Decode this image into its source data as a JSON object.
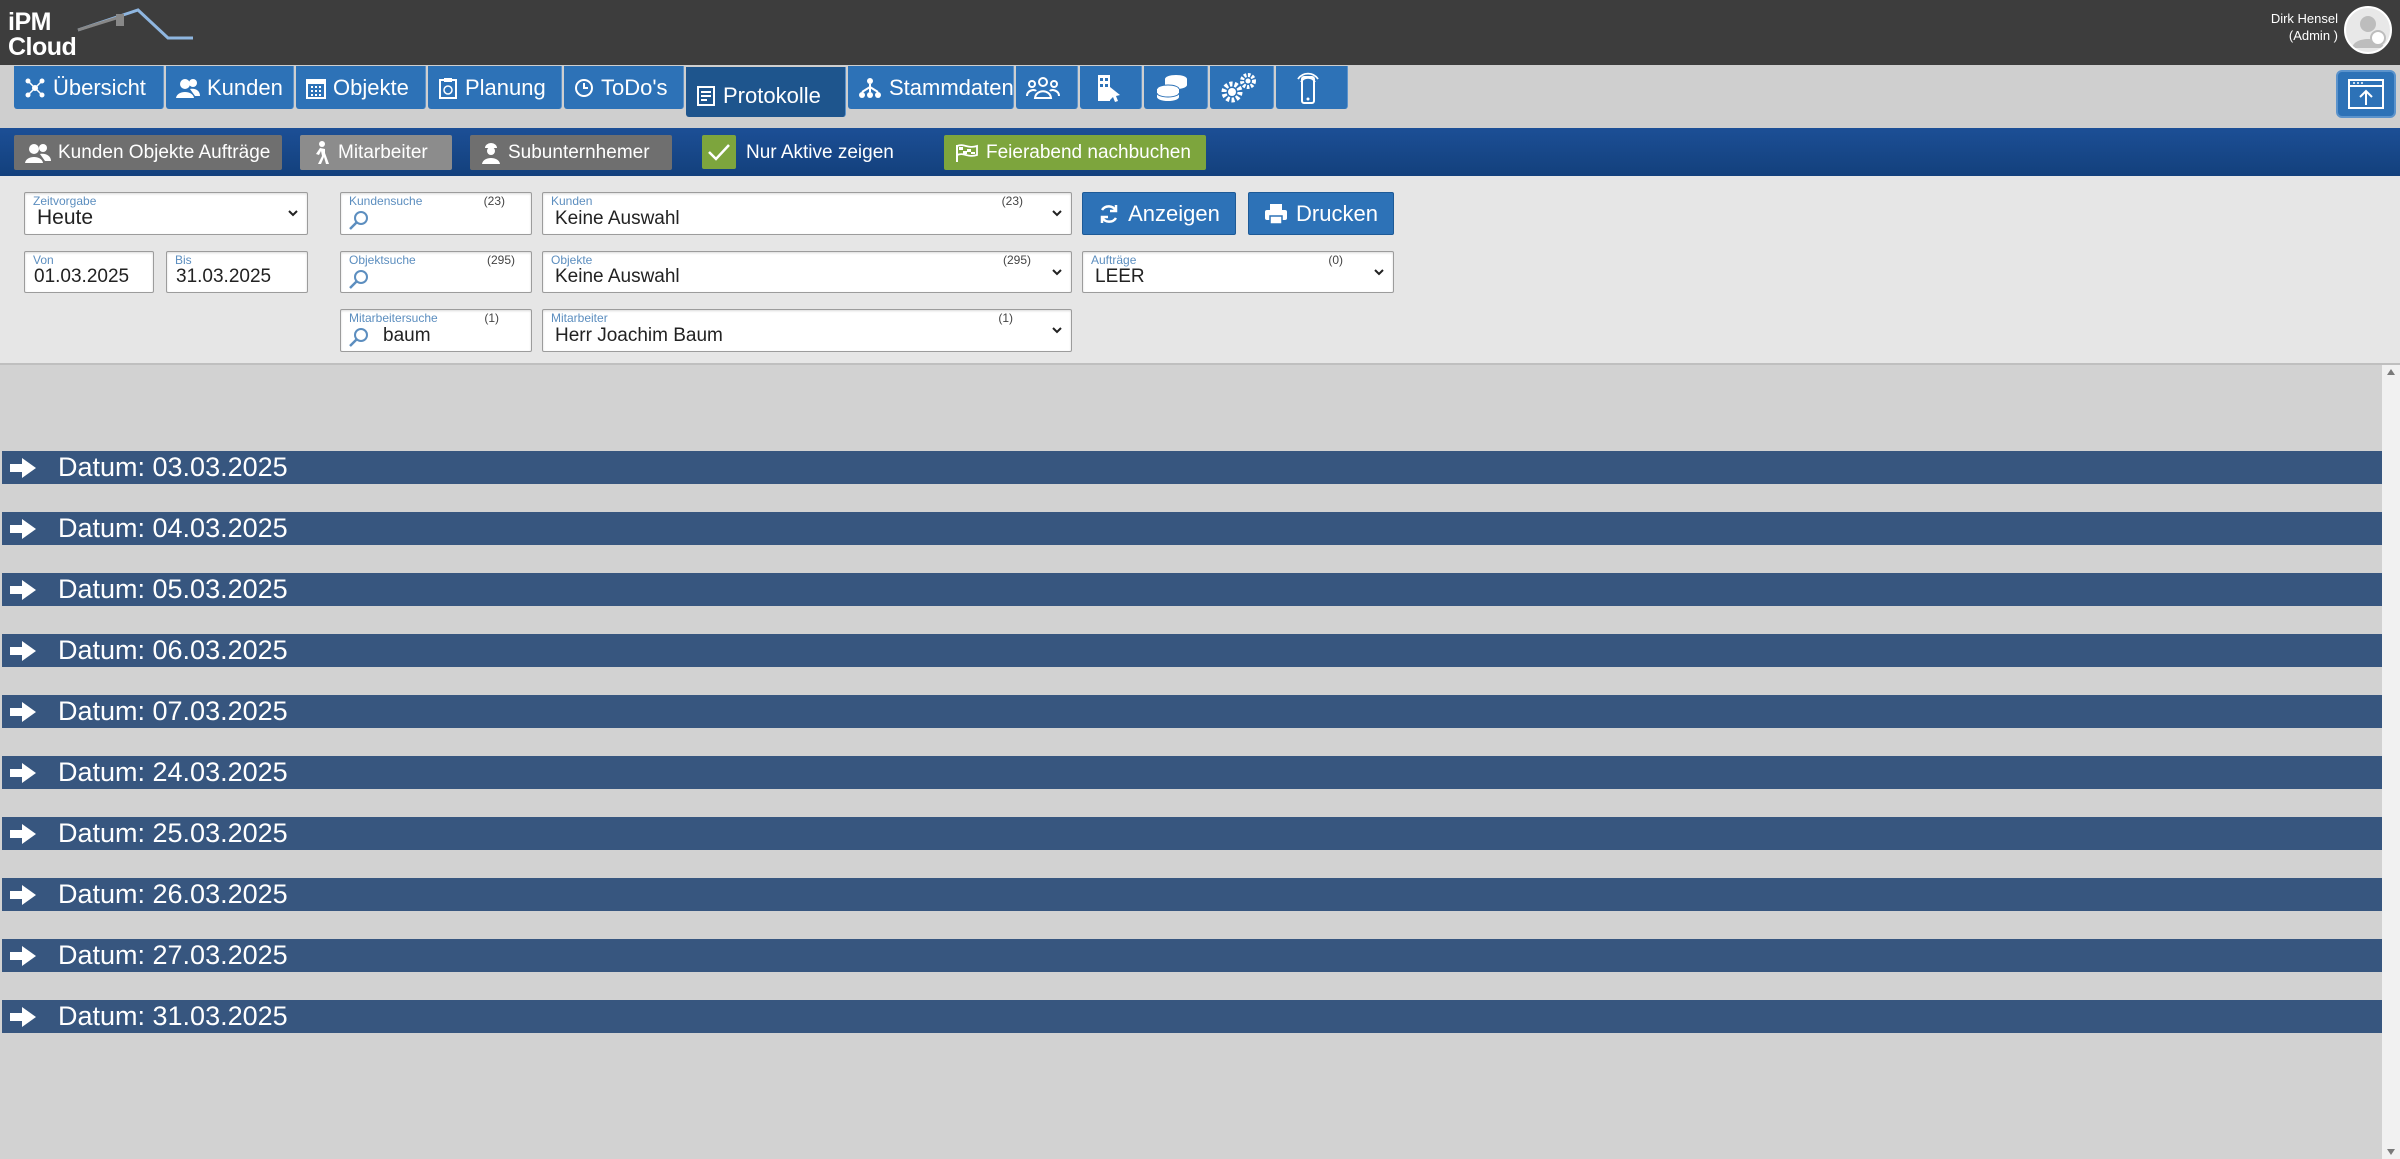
{
  "header": {
    "logo_line1": "iPM",
    "logo_line2": "Cloud",
    "user_name": "Dirk Hensel",
    "user_role": "(Admin )"
  },
  "nav": {
    "tabs": [
      {
        "label": "Übersicht",
        "icon": "network-icon"
      },
      {
        "label": "Kunden",
        "icon": "users-icon"
      },
      {
        "label": "Objekte",
        "icon": "building-icon"
      },
      {
        "label": "Planung",
        "icon": "clipboard-icon"
      },
      {
        "label": "ToDo's",
        "icon": "clock-icon"
      },
      {
        "label": "Protokolle",
        "icon": "document-icon"
      },
      {
        "label": "Stammdaten",
        "icon": "hierarchy-icon"
      }
    ],
    "icon_tabs": [
      "group-icon",
      "office-icon",
      "coins-icon",
      "gears-icon",
      "mobile-icon"
    ]
  },
  "band": {
    "btn_kunden": "Kunden Objekte Aufträge",
    "btn_mitarbeiter": "Mitarbeiter",
    "btn_subunternehmer": "Subunternhemer",
    "nur_aktive": "Nur Aktive zeigen",
    "feierabend": "Feierabend nachbuchen"
  },
  "filters": {
    "zeitvorgabe": {
      "label": "Zeitvorgabe",
      "value": "Heute"
    },
    "von": {
      "label": "Von",
      "value": "01.03.2025"
    },
    "bis": {
      "label": "Bis",
      "value": "31.03.2025"
    },
    "kundensuche": {
      "label": "Kundensuche",
      "count": "(23)",
      "value": ""
    },
    "kunden": {
      "label": "Kunden",
      "count": "(23)",
      "value": "Keine Auswahl"
    },
    "objektsuche": {
      "label": "Objektsuche",
      "count": "(295)",
      "value": ""
    },
    "objekte": {
      "label": "Objekte",
      "count": "(295)",
      "value": "Keine Auswahl"
    },
    "mitarbeitersuche": {
      "label": "Mitarbeitersuche",
      "count": "(1)",
      "value": "baum"
    },
    "mitarbeiter": {
      "label": "Mitarbeiter",
      "count": "(1)",
      "value": "Herr Joachim Baum"
    },
    "auftraege": {
      "label": "Aufträge",
      "count": "(0)",
      "value": "LEER"
    },
    "anzeigen": "Anzeigen",
    "drucken": "Drucken"
  },
  "dates": [
    "Datum: 03.03.2025",
    "Datum: 04.03.2025",
    "Datum: 05.03.2025",
    "Datum: 06.03.2025",
    "Datum: 07.03.2025",
    "Datum: 24.03.2025",
    "Datum: 25.03.2025",
    "Datum: 26.03.2025",
    "Datum: 27.03.2025",
    "Datum: 31.03.2025"
  ],
  "colors": {
    "nav_blue": "#2d72b7",
    "band_blue": "#1c4f96",
    "row_blue": "#37567f",
    "green": "#7da53d"
  }
}
